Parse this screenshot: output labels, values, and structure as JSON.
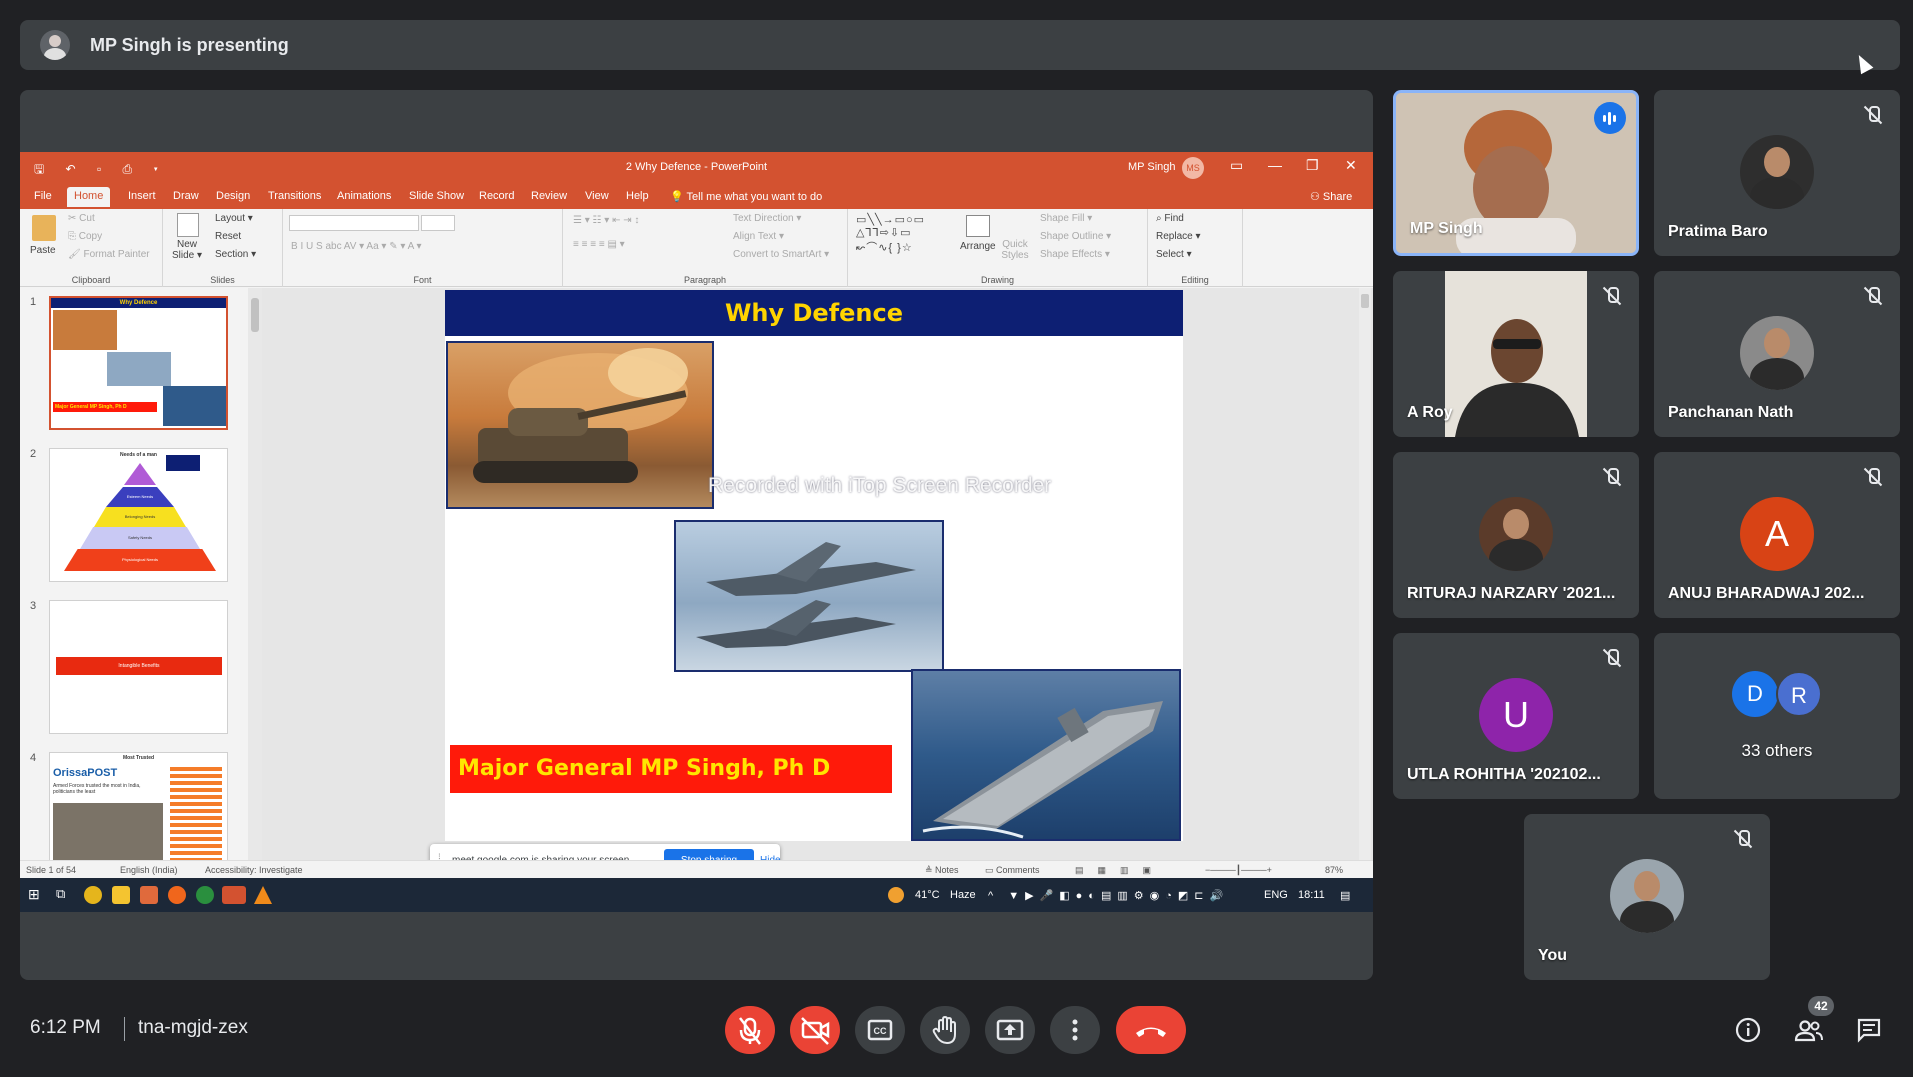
{
  "banner": {
    "text": "MP Singh is presenting"
  },
  "ppt": {
    "quick_access": "🖫 ↶ ▫ ⎙ ▾",
    "title": "2 Why Defence  -  PowerPoint",
    "user": "MP Singh",
    "user_initials": "MS",
    "tabs": [
      "File",
      "Home",
      "Insert",
      "Draw",
      "Design",
      "Transitions",
      "Animations",
      "Slide Show",
      "Record",
      "Review",
      "View",
      "Help"
    ],
    "tell_me": "💡 Tell me what you want to do",
    "share": "⚇ Share",
    "ribbon": {
      "clipboard": {
        "paste": "Paste",
        "cut": "✂ Cut",
        "copy": "⎘ Copy",
        "format_painter": "🖌 Format Painter",
        "label": "Clipboard"
      },
      "slides": {
        "new_slide": "New Slide ▾",
        "layout": "Layout ▾",
        "reset": "Reset",
        "section": "Section ▾",
        "label": "Slides"
      },
      "font": {
        "buttons": "B   I   U   S   abc   AV ▾   Aa ▾   ✎ ▾   A ▾",
        "label": "Font"
      },
      "paragraph": {
        "text_direction": "Text Direction ▾",
        "align_text": "Align Text ▾",
        "smartart": "Convert to SmartArt ▾",
        "label": "Paragraph"
      },
      "drawing": {
        "arrange": "Arrange",
        "quick_styles": "Quick Styles",
        "shape_fill": "Shape Fill ▾",
        "shape_outline": "Shape Outline ▾",
        "shape_effects": "Shape Effects ▾",
        "label": "Drawing"
      },
      "editing": {
        "find": "⌕ Find",
        "replace": "Replace ▾",
        "select": "Select ▾",
        "label": "Editing"
      }
    },
    "thumbnails": [
      {
        "num": "1",
        "title": "Why Defence",
        "footer": "Major General MP Singh, Ph D"
      },
      {
        "num": "2",
        "title": "Needs of a man",
        "pyramid": [
          "Self-Actualization",
          "Esteem Needs",
          "Belonging Needs",
          "Safety Needs",
          "Physiological Needs"
        ]
      },
      {
        "num": "3",
        "bar": "Intangible Benefits"
      },
      {
        "num": "4",
        "title": "Most Trusted",
        "brand": "OrissaPOST",
        "caption": "Armed Forces trusted the most in India, politicians the least"
      }
    ],
    "slide": {
      "title": "Why Defence",
      "author": "Major General MP Singh, Ph D",
      "watermark": "Recorded with iTop Screen Recorder"
    },
    "share_notice": {
      "grip": "⁞",
      "message": "meet.google.com is sharing your screen.",
      "stop": "Stop sharing",
      "hide": "Hide"
    },
    "status": {
      "slide": "Slide 1 of 54",
      "language": "English (India)",
      "accessibility": "Accessibility: Investigate",
      "notes": "≜ Notes",
      "comments": "▭ Comments",
      "zoom": "87%"
    },
    "taskbar": {
      "weather_temp": "41°C",
      "weather_desc": "Haze",
      "lang": "ENG",
      "time": "18:11"
    }
  },
  "tiles": [
    {
      "name": "MP Singh",
      "speaking": true
    },
    {
      "name": "Pratima Baro"
    },
    {
      "name": "A Roy"
    },
    {
      "name": "Panchanan Nath"
    },
    {
      "name": "RITURAJ NARZARY '2021..."
    },
    {
      "name": "ANUJ BHARADWAJ 202...",
      "initial": "A"
    },
    {
      "name": "UTLA ROHITHA '202102...",
      "initial": "U"
    },
    {
      "name": "33 others",
      "initials": [
        "D",
        "R"
      ]
    },
    {
      "name": "You"
    }
  ],
  "colors": {
    "avatar_anuj": "#d84315",
    "avatar_utla": "#8e24aa",
    "avatar_d": "#1a73e8",
    "avatar_r": "#4a6fd0",
    "ppt_accent": "#d35230",
    "end_call": "#ea4335",
    "speaking": "#8ab4f8"
  },
  "meeting": {
    "time": "6:12 PM",
    "code": "tna-mgjd-zex",
    "participants_count": "42"
  },
  "controls": {
    "mic": "mic-off-icon",
    "camera": "camera-off-icon",
    "captions": "captions-icon",
    "hand": "raise-hand-icon",
    "present": "present-icon",
    "more": "more-options-icon",
    "end": "end-call-icon",
    "info": "info-icon",
    "people": "people-icon",
    "chat": "chat-icon"
  }
}
